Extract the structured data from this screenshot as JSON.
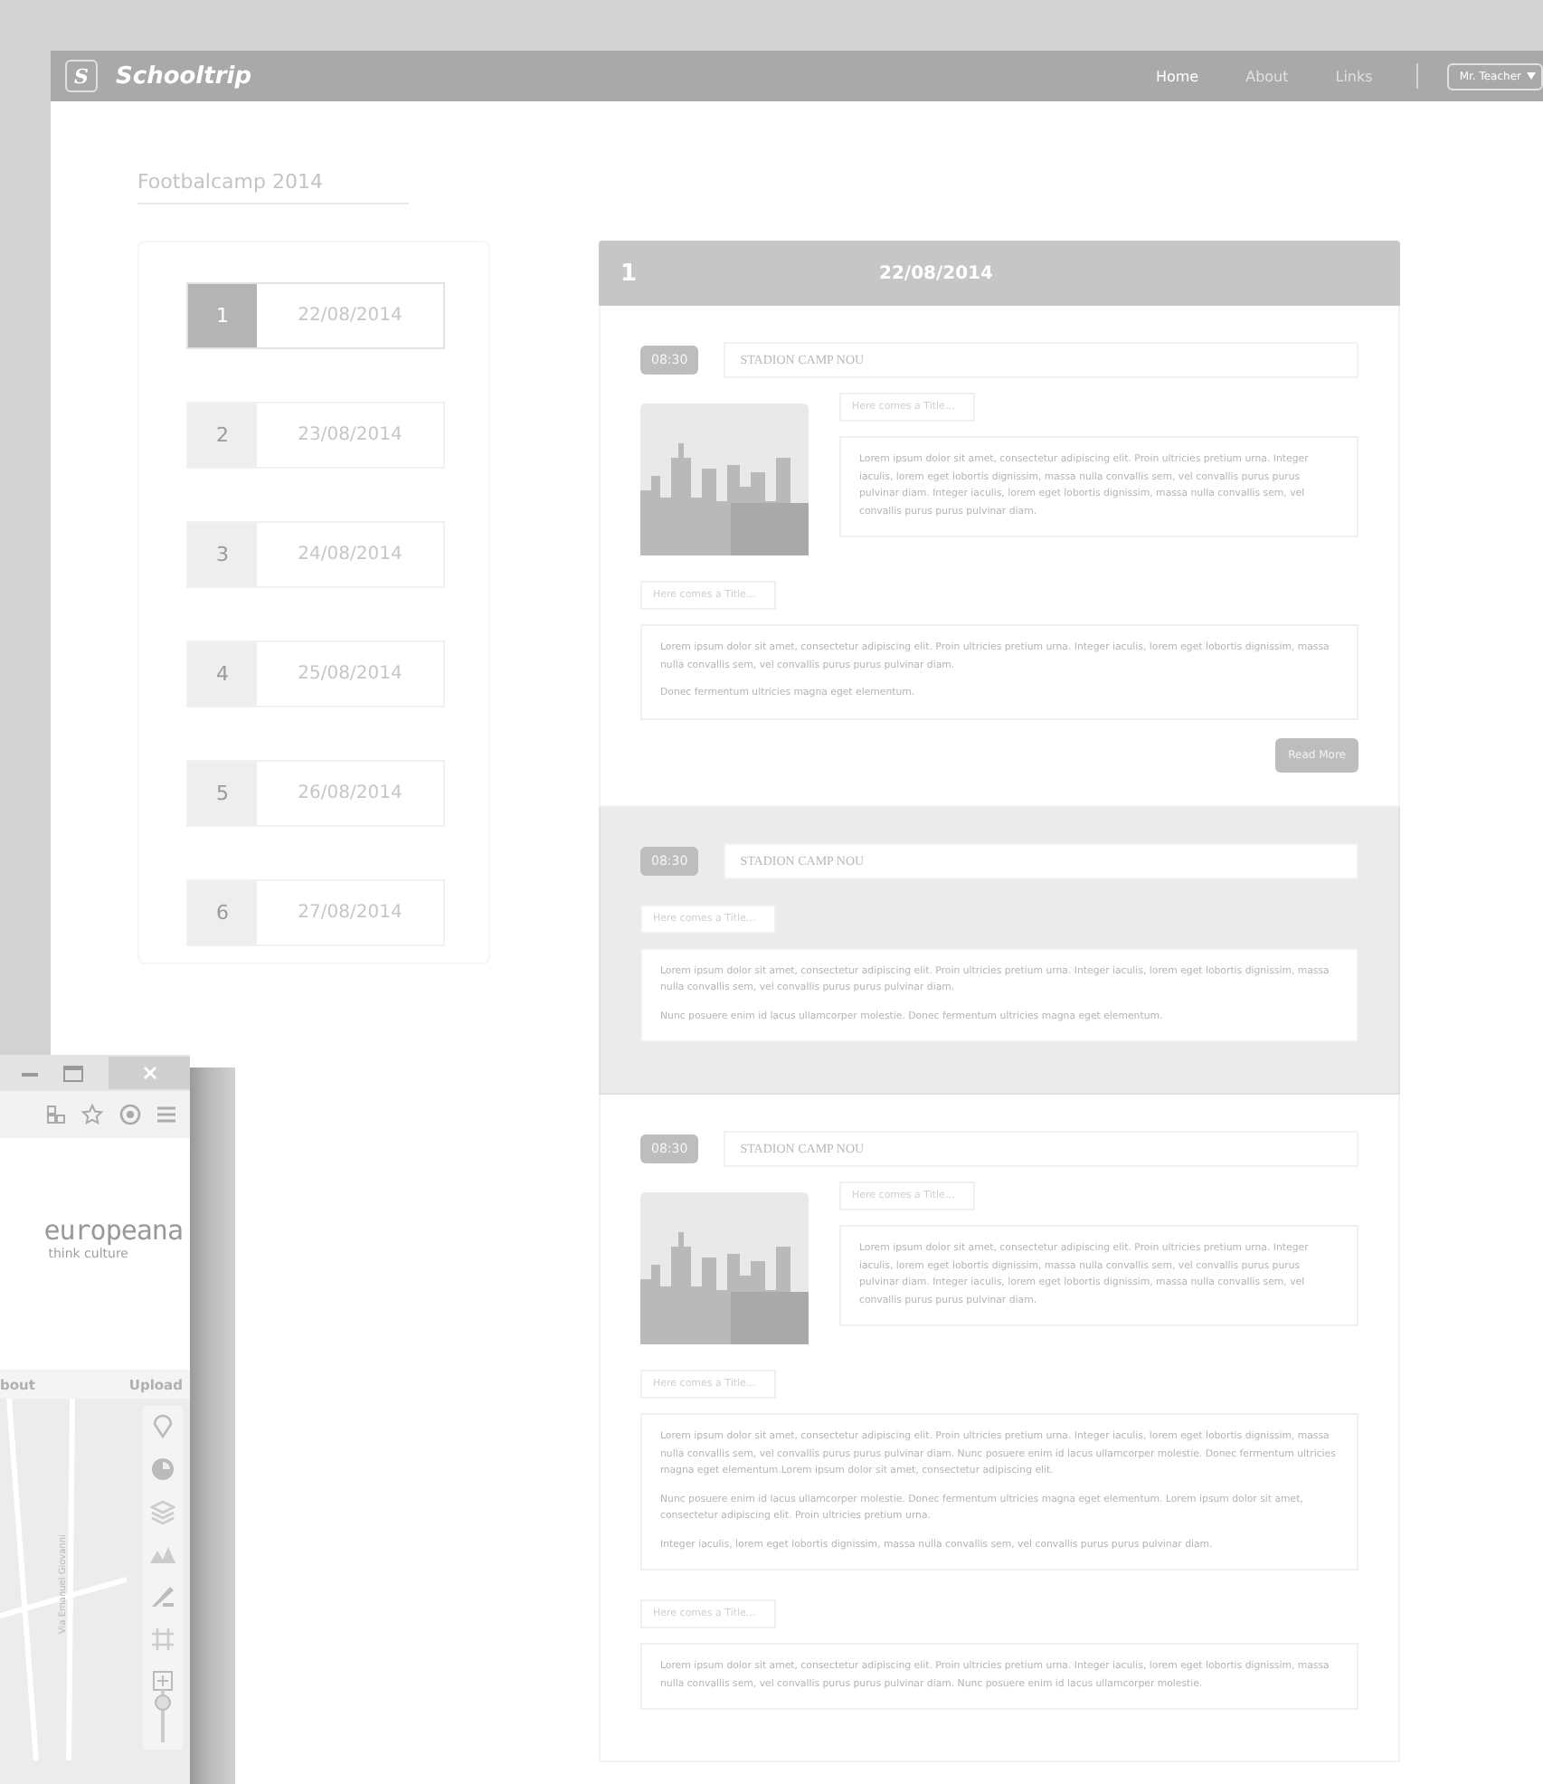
{
  "navbar": {
    "logo_letter": "S",
    "brand": "Schooltrip",
    "links": [
      {
        "label": "Home",
        "selected": true
      },
      {
        "label": "About",
        "selected": false
      },
      {
        "label": "Links",
        "selected": false
      }
    ],
    "user_menu": "Mr. Teacher"
  },
  "page_title": "Footbalcamp 2014",
  "days": [
    {
      "number": "1",
      "date": "22/08/2014",
      "selected": true
    },
    {
      "number": "2",
      "date": "23/08/2014",
      "selected": false
    },
    {
      "number": "3",
      "date": "24/08/2014",
      "selected": false
    },
    {
      "number": "4",
      "date": "25/08/2014",
      "selected": false
    },
    {
      "number": "5",
      "date": "26/08/2014",
      "selected": false
    },
    {
      "number": "6",
      "date": "27/08/2014",
      "selected": false
    }
  ],
  "day_panel": {
    "number": "1",
    "date": "22/08/2014"
  },
  "events": [
    {
      "time": "08:30",
      "title": "STADION CAMP NOU",
      "selected": false,
      "blocks": [
        {
          "kind": "image_text",
          "tab": "Here comes a Title...",
          "paragraphs": [
            "Lorem ipsum dolor sit amet, consectetur adipiscing elit. Proin ultricies pretium urna. Integer iaculis, lorem eget lobortis dignissim, massa nulla convallis sem, vel convallis purus purus pulvinar diam. Integer iaculis, lorem eget lobortis dignissim, massa nulla convallis sem, vel convallis purus purus pulvinar diam."
          ]
        },
        {
          "kind": "text",
          "tab": "Here comes a Title...",
          "paragraphs": [
            "Lorem ipsum dolor sit amet, consectetur adipiscing elit. Proin ultricies pretium urna. Integer iaculis, lorem eget lobortis dignissim, massa nulla convallis sem, vel convallis purus purus pulvinar diam.",
            "Donec fermentum ultricies magna eget elementum."
          ]
        }
      ],
      "button": "Read More"
    },
    {
      "time": "08:30",
      "title": "STADION CAMP NOU",
      "selected": true,
      "blocks": [
        {
          "kind": "text",
          "tab": "Here comes a Title...",
          "paragraphs": [
            "Lorem ipsum dolor sit amet, consectetur adipiscing elit. Proin ultricies pretium urna. Integer iaculis, lorem eget lobortis dignissim, massa nulla convallis sem, vel convallis purus purus pulvinar diam.",
            "Nunc posuere enim id lacus ullamcorper molestie. Donec fermentum ultricies magna eget elementum."
          ]
        }
      ]
    },
    {
      "time": "08:30",
      "title": "STADION CAMP NOU",
      "selected": false,
      "blocks": [
        {
          "kind": "image_text",
          "tab": "Here comes a Title...",
          "paragraphs": [
            "Lorem ipsum dolor sit amet, consectetur adipiscing elit. Proin ultricies pretium urna. Integer iaculis, lorem eget lobortis dignissim, massa nulla convallis sem, vel convallis purus purus pulvinar diam. Integer iaculis, lorem eget lobortis dignissim, massa nulla convallis sem, vel convallis purus purus pulvinar diam."
          ]
        },
        {
          "kind": "text",
          "tab": "Here comes a Title...",
          "paragraphs": [
            "Lorem ipsum dolor sit amet, consectetur adipiscing elit. Proin ultricies pretium urna. Integer iaculis, lorem eget lobortis dignissim, massa nulla convallis sem, vel convallis purus purus pulvinar diam. Nunc posuere enim id lacus ullamcorper molestie. Donec fermentum ultricies magna eget elementum.Lorem ipsum dolor sit amet, consectetur adipiscing elit.",
            "Nunc posuere enim id lacus ullamcorper molestie. Donec fermentum ultricies magna eget elementum. Lorem ipsum dolor sit amet, consectetur adipiscing elit. Proin ultricies pretium urna.",
            "Integer iaculis, lorem eget lobortis dignissim, massa nulla convallis sem, vel convallis purus purus pulvinar diam."
          ]
        },
        {
          "kind": "text",
          "tab": "Here comes a Title...",
          "paragraphs": [
            "Lorem ipsum dolor sit amet, consectetur adipiscing elit. Proin ultricies pretium urna. Integer iaculis, lorem eget lobortis dignissim, massa nulla convallis sem, vel convallis purus purus pulvinar diam. Nunc posuere enim id lacus ullamcorper molestie."
          ]
        }
      ]
    }
  ],
  "browser_window": {
    "logo": "europeana",
    "tagline": "think culture",
    "nav": [
      "bout",
      "Upload"
    ],
    "map_street": "Via Emanuel Giovanni"
  }
}
